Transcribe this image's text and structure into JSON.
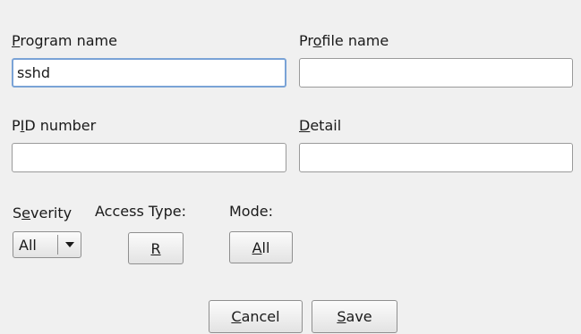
{
  "filter": {
    "program_name": {
      "label_mnemonic": "P",
      "label_rest": "rogram name",
      "value": "sshd"
    },
    "profile_name": {
      "label_pre": "Pr",
      "label_mnemonic": "o",
      "label_rest": "file name",
      "value": ""
    },
    "pid_number": {
      "label_pre": "P",
      "label_mnemonic": "I",
      "label_rest": "D number",
      "value": ""
    },
    "detail": {
      "label_mnemonic": "D",
      "label_rest": "etail",
      "value": ""
    },
    "severity": {
      "label_pre": "S",
      "label_mnemonic": "e",
      "label_rest": "verity",
      "selected": "All"
    },
    "access_type": {
      "label": "Access Type:",
      "button_label": "R"
    },
    "mode": {
      "label": "Mode:",
      "button_mnemonic": "A",
      "button_rest": "ll"
    }
  },
  "actions": {
    "cancel": {
      "mnemonic": "C",
      "rest": "ancel"
    },
    "save": {
      "mnemonic": "S",
      "rest": "ave"
    }
  },
  "icons": {
    "dropdown": "triangle-down-icon"
  }
}
